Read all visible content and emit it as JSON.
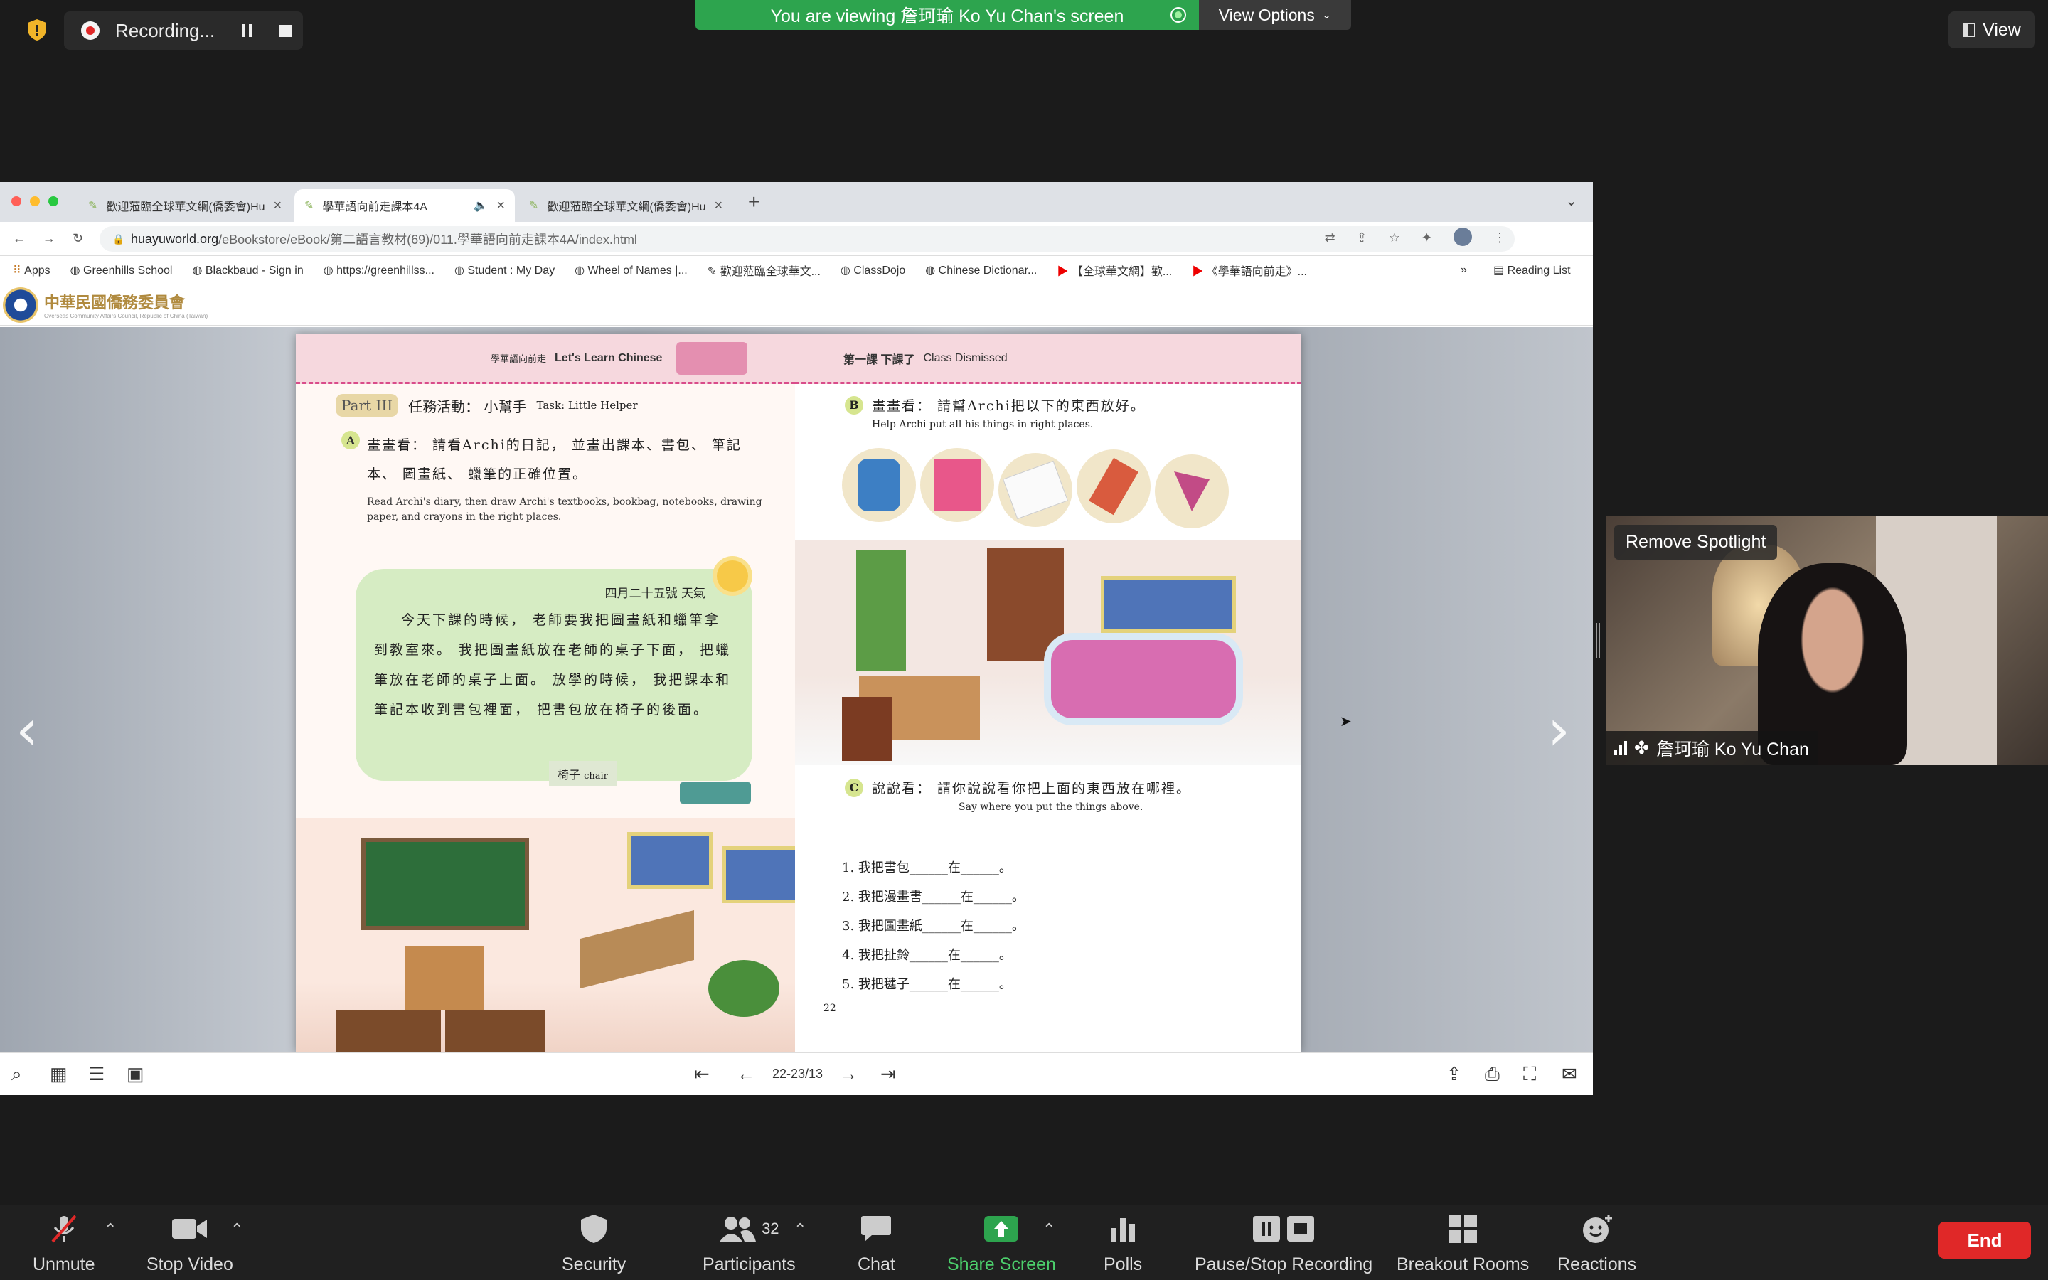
{
  "zoom": {
    "recording_label": "Recording...",
    "viewing_banner": "You are viewing 詹珂瑜 Ko Yu Chan's screen",
    "view_options": "View Options",
    "view_button": "View",
    "remove_spotlight": "Remove Spotlight",
    "participant_name": "詹珂瑜 Ko Yu Chan",
    "controls": {
      "unmute": "Unmute",
      "stop_video": "Stop Video",
      "security": "Security",
      "participants": "Participants",
      "participants_count": "32",
      "chat": "Chat",
      "share_screen": "Share Screen",
      "polls": "Polls",
      "pause_stop_recording": "Pause/Stop Recording",
      "breakout_rooms": "Breakout Rooms",
      "reactions": "Reactions",
      "end": "End"
    },
    "colors": {
      "green": "#2da44e",
      "red": "#e02828"
    }
  },
  "browser": {
    "tabs": [
      {
        "title": "歡迎蒞臨全球華文網(僑委會)Hu"
      },
      {
        "title": "學華語向前走課本4A"
      },
      {
        "title": "歡迎蒞臨全球華文網(僑委會)Hu"
      }
    ],
    "url_domain": "huayuworld.org",
    "url_path": "/eBookstore/eBook/第二語言教材(69)/011.學華語向前走課本4A/index.html",
    "bookmarks": [
      "Apps",
      "Greenhills School",
      "Blackbaud - Sign in",
      "https://greenhillss...",
      "Student : My Day",
      "Wheel of Names |...",
      "歡迎蒞臨全球華文...",
      "ClassDojo",
      "Chinese Dictionar...",
      "【全球華文網】歡...",
      "《學華語向前走》..."
    ],
    "reading_list": "Reading List",
    "site_logo": "中華民國僑務委員會",
    "site_logo_sub": "Overseas Community Affairs Council, Republic of China (Taiwan)"
  },
  "reader": {
    "page_indicator": "22-23/13"
  },
  "book": {
    "left_header_cn": "學華語向前走",
    "left_header_en": "Let's Learn Chinese",
    "part": "Part III",
    "task_cn": "任務活動： 小幫手",
    "task_en": "Task: Little Helper",
    "a_cn": "畫畫看： 請看Archi的日記， 並畫出課本、書包、 筆記本、 圖畫紙、 蠟筆的正確位置。",
    "a_en": "Read Archi's diary, then draw Archi's textbooks, bookbag, notebooks, drawing paper, and crayons in the right places.",
    "diary_date": "四月二十五號 天氣",
    "diary_text": "今天下課的時候， 老師要我把圖畫紙和蠟筆拿到教室來。 我把圖畫紙放在老師的桌子下面， 把蠟筆放在老師的桌子上面。 放學的時候， 我把課本和筆記本收到書包裡面， 把書包放在椅子的後面。",
    "chair_cn": "椅子",
    "chair_en": "chair",
    "right_header_cn": "第一課 下課了",
    "right_header_en": "Class Dismissed",
    "b_cn": "畫畫看： 請幫Archi把以下的東西放好。",
    "b_en": "Help Archi put all his things in right places.",
    "c_cn": "說說看： 請你說說看你把上面的東西放在哪裡。",
    "c_en": "Say where you put the things above.",
    "exercises": [
      "1. 我把書包______在______。",
      "2. 我把漫畫書______在______。",
      "3. 我把圖畫紙______在______。",
      "4. 我把扯鈴______在______。",
      "5. 我把毽子______在______。"
    ],
    "page_number": "22"
  }
}
